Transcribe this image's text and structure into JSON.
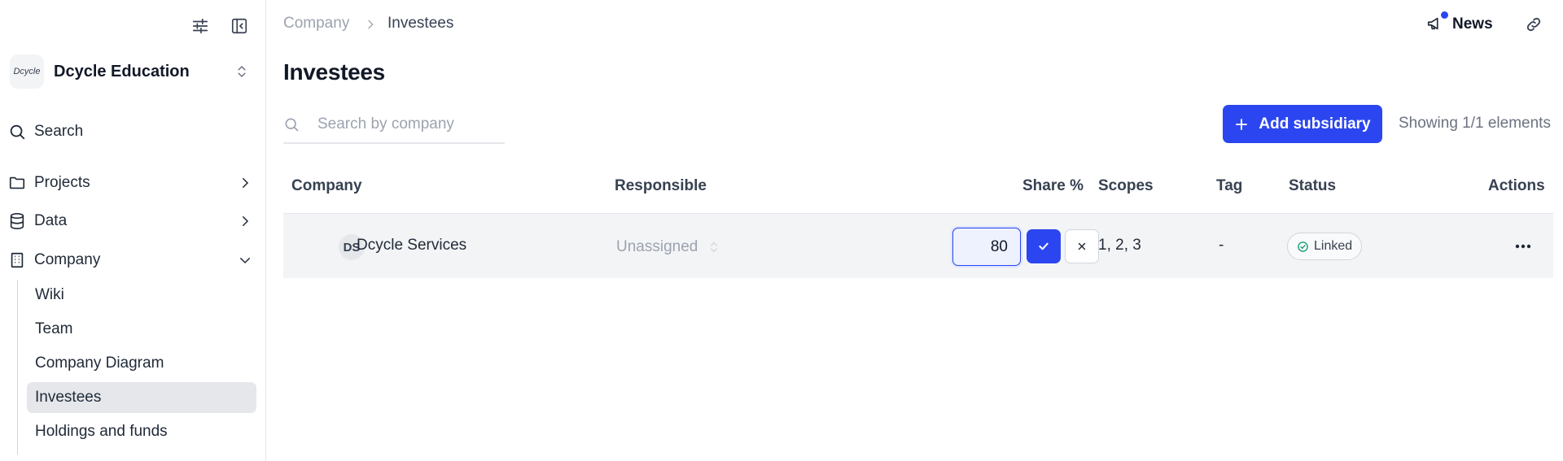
{
  "sidebar": {
    "org": {
      "logo_text": "Dcycle",
      "name": "Dcycle Education"
    },
    "nav": [
      {
        "label": "Search"
      },
      {
        "label": "Projects"
      },
      {
        "label": "Data"
      },
      {
        "label": "Company"
      }
    ],
    "company_sub": [
      {
        "label": "Wiki"
      },
      {
        "label": "Team"
      },
      {
        "label": "Company Diagram"
      },
      {
        "label": "Investees"
      },
      {
        "label": "Holdings and funds"
      }
    ]
  },
  "header": {
    "breadcrumb": [
      "Company",
      "Investees"
    ],
    "news_label": "News"
  },
  "page": {
    "title": "Investees",
    "search_placeholder": "Search by company",
    "add_button_label": "Add subsidiary",
    "showing_text": "Showing 1/1 elements"
  },
  "table": {
    "headers": [
      "Company",
      "Responsible",
      "Share %",
      "Scopes",
      "Tag",
      "Status",
      "Actions"
    ],
    "rows": [
      {
        "initials": "DS",
        "company": "Dcycle Services",
        "responsible": "Unassigned",
        "share_value": "80",
        "scopes": "1, 2, 3",
        "tag": "-",
        "status": "Linked"
      }
    ]
  },
  "colors": {
    "primary": "#2b46f0",
    "notification_dot": "#2b46f0",
    "row_bg": "#f3f4f6"
  }
}
